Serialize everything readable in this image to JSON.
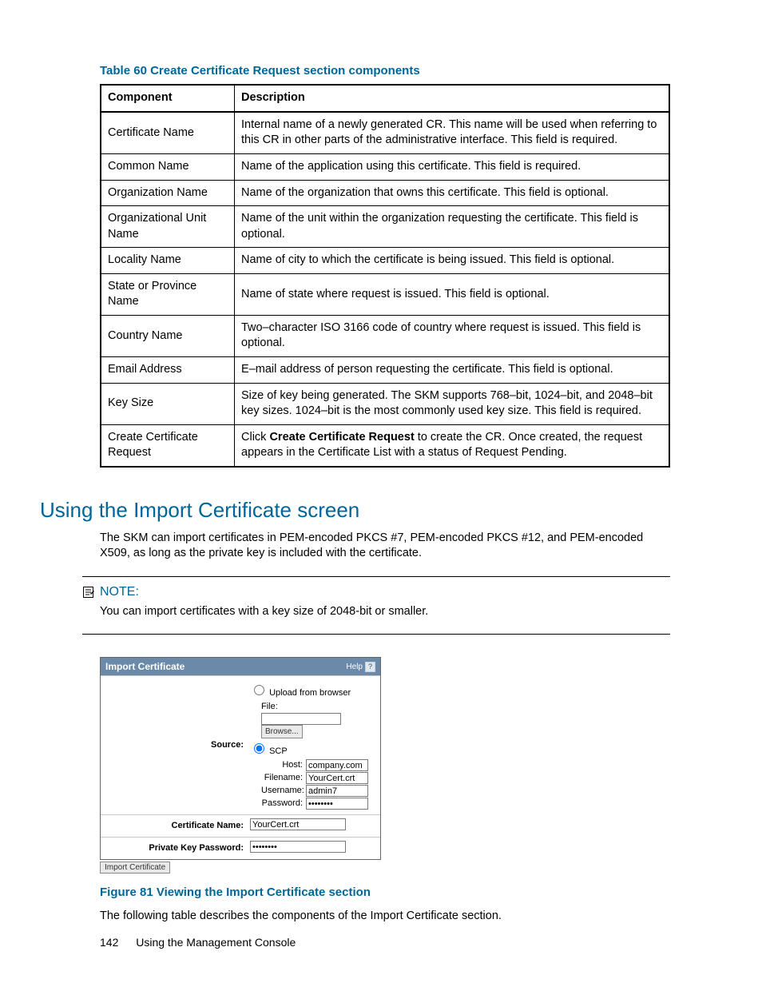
{
  "table_caption": "Table 60 Create Certificate Request section components",
  "table_headers": {
    "c0": "Component",
    "c1": "Description"
  },
  "table_rows": [
    {
      "c0": "Certificate Name",
      "c1": "Internal name of a newly generated CR. This name will be used when referring to this CR in other parts of the administrative interface. This field is required."
    },
    {
      "c0": "Common Name",
      "c1": "Name of the application using this certificate. This field is required."
    },
    {
      "c0": "Organization Name",
      "c1": "Name of the organization that owns this certificate. This field is optional."
    },
    {
      "c0": "Organizational Unit Name",
      "c1": "Name of the unit within the organization requesting the certificate. This field is optional."
    },
    {
      "c0": "Locality Name",
      "c1": "Name of city to which the certificate is being issued. This field is optional."
    },
    {
      "c0": "State or Province Name",
      "c1": "Name of state where request is issued. This field is optional."
    },
    {
      "c0": "Country Name",
      "c1": "Two–character ISO 3166 code of country where request is issued. This field is optional."
    },
    {
      "c0": "Email Address",
      "c1": "E–mail address of person requesting the certificate. This field is optional."
    },
    {
      "c0": "Key Size",
      "c1": "Size of key being generated. The SKM supports 768–bit, 1024–bit, and 2048–bit key sizes. 1024–bit is the most commonly used key size. This field is required."
    },
    {
      "c0": "Create Certificate Request",
      "c1_prefix": "Click ",
      "c1_bold": "Create Certificate Request",
      "c1_suffix": " to create the CR. Once created, the request appears in the Certificate List with a status of Request Pending."
    }
  ],
  "section_heading": "Using the Import Certificate screen",
  "intro_paragraph": "The SKM can import certificates in PEM-encoded PKCS #7, PEM-encoded PKCS #12, and PEM-encoded X509, as long as the private key is included with the certificate.",
  "note_label": "NOTE:",
  "note_text": "You can import certificates with a key size of 2048-bit or smaller.",
  "import_ui": {
    "title": "Import Certificate",
    "help_label": "Help",
    "help_glyph": "?",
    "source_label": "Source:",
    "upload_radio_label": "Upload from browser",
    "file_label": "File:",
    "browse_button": "Browse...",
    "scp_radio_label": "SCP",
    "host_label": "Host:",
    "host_value": "company.com",
    "filename_label": "Filename:",
    "filename_value": "YourCert.crt",
    "username_label": "Username:",
    "username_value": "admin7",
    "password_label": "Password:",
    "password_value": "********",
    "cert_name_label": "Certificate Name:",
    "cert_name_value": "YourCert.crt",
    "pk_password_label": "Private Key Password:",
    "pk_password_value": "********",
    "submit_button": "Import Certificate"
  },
  "figure_caption": "Figure 81 Viewing the Import Certificate section",
  "figure_followup": "The following table describes the components of the Import Certificate section.",
  "footer": {
    "page_number": "142",
    "section": "Using the Management Console"
  }
}
